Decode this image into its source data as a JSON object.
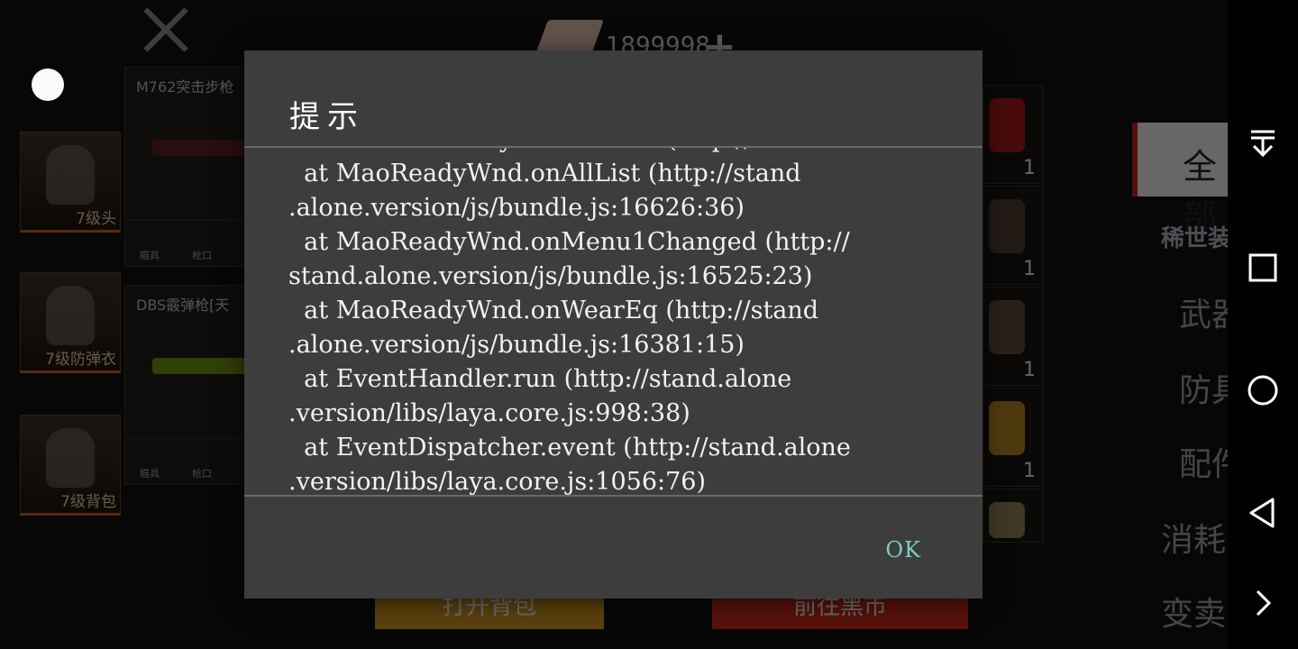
{
  "background": {
    "currency_value": "1899998",
    "equipment_slots": [
      {
        "label": "7级头"
      },
      {
        "label": "7级防弹衣"
      },
      {
        "label": "7级背包"
      }
    ],
    "weapons": [
      {
        "name": "M762突击步枪",
        "attachments": [
          "瞄具",
          "枪口"
        ]
      },
      {
        "name": "DBS霰弹枪[天",
        "attachments": [
          "瞄具",
          "枪口"
        ]
      }
    ],
    "inventory_counts": [
      "1",
      "1",
      "1",
      "1",
      "1"
    ],
    "bottom_buttons": [
      "打开背包",
      "前往黑市"
    ],
    "filter_selected": "全部",
    "categories": [
      "稀世装",
      "武器",
      "防具",
      "配件",
      "消耗",
      "变卖"
    ]
  },
  "dialog": {
    "title": "提示",
    "message_lines": [
      "        at MaoReadyWnd.xxxxxx (http://stand.alone.version/",
      "  at MaoReadyWnd.onAllList (http://stand",
      ".alone.version/js/bundle.js:16626:36)",
      "  at MaoReadyWnd.onMenu1Changed (http://",
      "stand.alone.version/js/bundle.js:16525:23)",
      "  at MaoReadyWnd.onWearEq (http://stand",
      ".alone.version/js/bundle.js:16381:15)",
      "  at EventHandler.run (http://stand.alone",
      ".version/libs/laya.core.js:998:38)",
      "  at EventDispatcher.event (http://stand.alone",
      ".version/libs/laya.core.js:1056:76)"
    ],
    "ok_label": "OK"
  },
  "colors": {
    "dialog_bg": "#3d3d3d",
    "ok_accent": "#80cbc4",
    "divider": "#6a6a6a"
  },
  "nav_icons": [
    "pull-down-icon",
    "recents-square-icon",
    "home-circle-icon",
    "back-triangle-icon",
    "chevron-right-icon"
  ]
}
